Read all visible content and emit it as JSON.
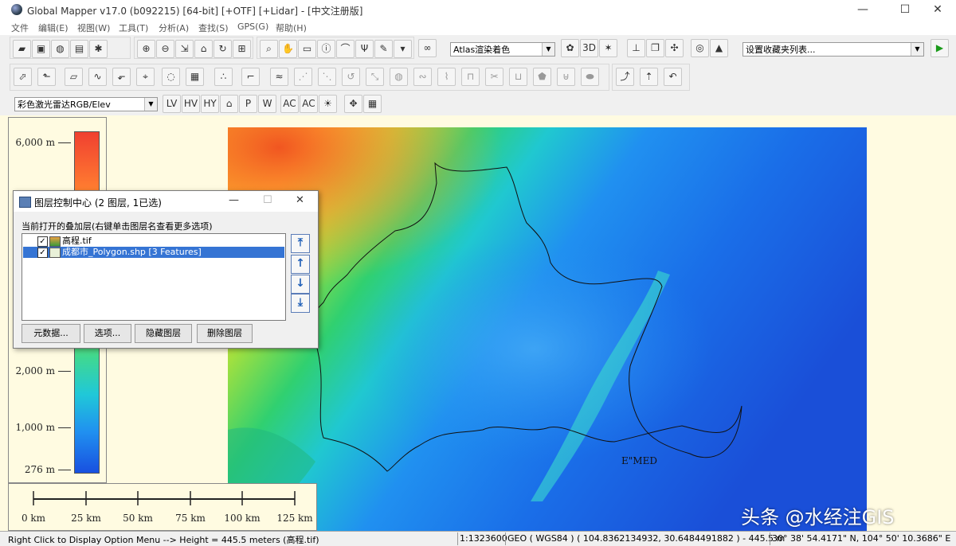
{
  "window": {
    "title": "Global Mapper v17.0 (b092215) [64-bit] [+OTF] [+Lidar] - [中文注册版]",
    "controls": {
      "minimize": "—",
      "maximize": "☐",
      "close": "✕"
    }
  },
  "menu": {
    "items": [
      "文件",
      "编辑(E)",
      "视图(W)",
      "工具(T)",
      "分析(A)",
      "查找(S)",
      "GPS(G)",
      "帮助(H)"
    ]
  },
  "toolbar": {
    "shader_select": {
      "value": "Atlas渲染着色"
    },
    "favorites_select": {
      "value": "设置收藏夹列表..."
    },
    "lidar_color_select": {
      "value": "彩色激光雷达RGB/Elev"
    },
    "run_label": "▶"
  },
  "legend": {
    "labels": [
      {
        "text": "6,000 m",
        "value": 6000
      },
      {
        "text": "2,000 m",
        "value": 2000
      },
      {
        "text": "1,000 m",
        "value": 1000
      },
      {
        "text": "276 m",
        "value": 276
      }
    ],
    "colors": [
      "#f04030",
      "#ff7a30",
      "#ffc020",
      "#e8f020",
      "#7fe050",
      "#40d890",
      "#20c8d8",
      "#2090f0",
      "#1850e0"
    ]
  },
  "scalebar": {
    "labels": [
      "0 km",
      "25 km",
      "50 km",
      "75 km",
      "100 km",
      "125 km"
    ]
  },
  "map": {
    "feature_label": "E\"MED"
  },
  "dialog": {
    "title": "图层控制中心 (2 图层, 1已选)",
    "caption": "当前打开的叠加层(右键单击图层名查看更多选项)",
    "layers": [
      {
        "name": "高程.tif",
        "checked": true,
        "selected": false
      },
      {
        "name": "成都市_Polygon.shp [3 Features]",
        "checked": true,
        "selected": true
      }
    ],
    "buttons": {
      "metadata": "元数据...",
      "options": "选项...",
      "hide": "隐藏图层",
      "delete": "删除图层"
    },
    "controls": {
      "minimize": "—",
      "maximize": "☐",
      "close": "✕"
    },
    "check_mark": "✓"
  },
  "status": {
    "hint": "Right Click to Display Option Menu --> Height = 445.5 meters (高程.tif)",
    "scale": "1:1323600",
    "coords": "GEO ( WGS84 ) ( 104.8362134932, 30.6484491882 ) - 445.5 m",
    "dms": "30° 38' 54.4171\" N, 104° 50' 10.3686\" E"
  },
  "watermark": "头条 @水经注GIS",
  "accent_colors": {
    "selection": "#3574d4",
    "map_background": "#fffbe1"
  }
}
